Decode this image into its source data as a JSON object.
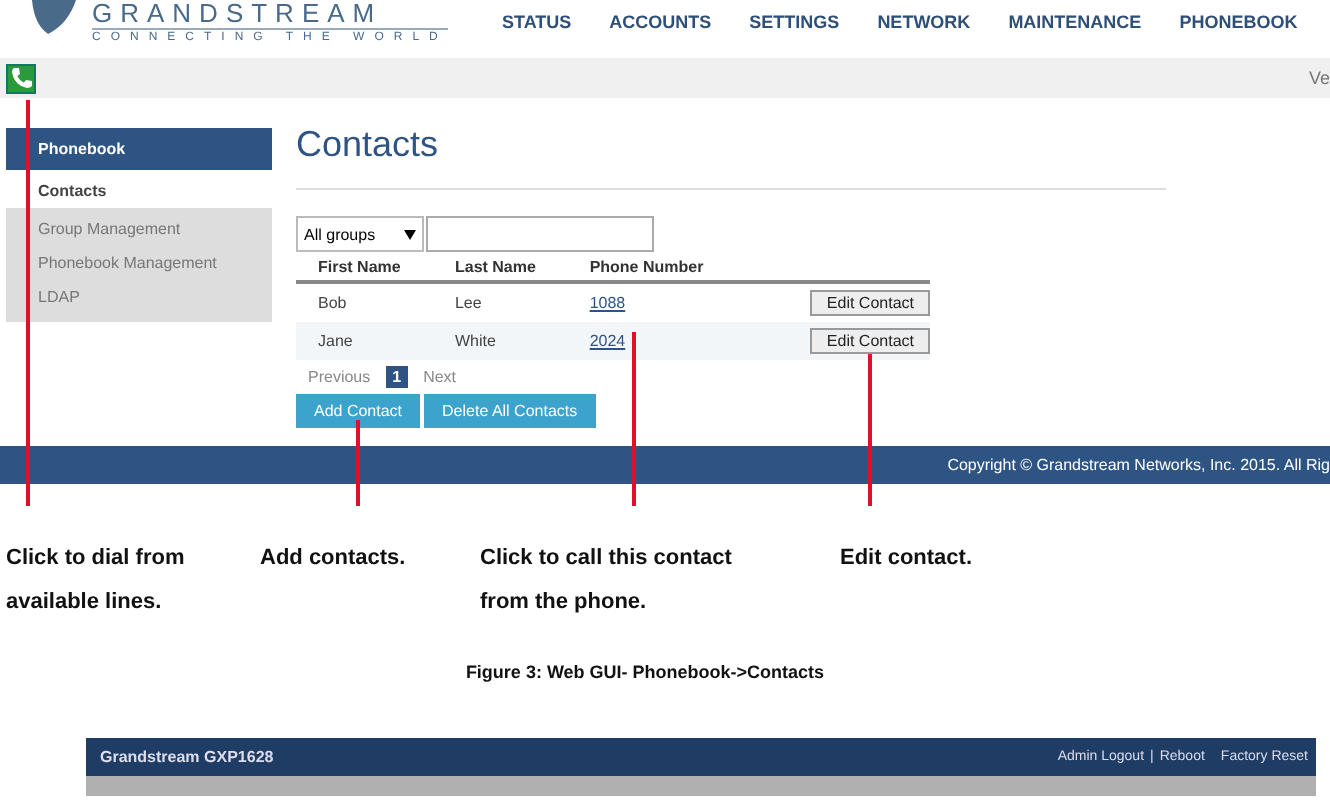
{
  "header": {
    "logo_text": "GRANDSTREAM",
    "tagline": "CONNECTING THE WORLD",
    "nav": [
      {
        "label": "STATUS"
      },
      {
        "label": "ACCOUNTS"
      },
      {
        "label": "SETTINGS"
      },
      {
        "label": "NETWORK"
      },
      {
        "label": "MAINTENANCE"
      },
      {
        "label": "PHONEBOOK"
      }
    ]
  },
  "toolbar": {
    "version_text": "Ve"
  },
  "sidebar": {
    "title": "Phonebook",
    "items": [
      {
        "label": "Contacts",
        "selected": true
      },
      {
        "label": "Group Management",
        "selected": false
      },
      {
        "label": "Phonebook Management",
        "selected": false
      },
      {
        "label": "LDAP",
        "selected": false
      }
    ]
  },
  "page": {
    "title": "Contacts",
    "group_select": "All groups",
    "columns": [
      "First Name",
      "Last Name",
      "Phone Number"
    ],
    "rows": [
      {
        "first": "Bob",
        "last": "Lee",
        "phone": "1088",
        "action": "Edit Contact"
      },
      {
        "first": "Jane",
        "last": "White",
        "phone": "2024",
        "action": "Edit Contact"
      }
    ],
    "pagination": [
      {
        "label": "Previous",
        "kind": "nav",
        "disabled": true,
        "selected": false
      },
      {
        "label": "1",
        "kind": "page",
        "disabled": false,
        "selected": true
      },
      {
        "label": "Next",
        "kind": "nav",
        "disabled": true,
        "selected": false
      }
    ],
    "buttons": [
      "Add Contact",
      "Delete All Contacts"
    ]
  },
  "footer": {
    "copyright": "Copyright © Grandstream Networks, Inc. 2015. All Rig"
  },
  "annotations": [
    {
      "lines": [
        "Click to dial from",
        "available lines."
      ]
    },
    {
      "lines": [
        "Add contacts."
      ]
    },
    {
      "lines": [
        "Click to call this contact",
        "from the phone."
      ]
    },
    {
      "lines": [
        "Edit contact."
      ]
    }
  ],
  "figure_caption": "Figure 3: Web GUI- Phonebook->Contacts",
  "second_screen": {
    "title": "Grandstream GXP1628",
    "links": [
      {
        "kind": "link",
        "text": "Admin Logout"
      },
      {
        "kind": "separator",
        "text": "|"
      },
      {
        "kind": "link",
        "text": "Reboot"
      },
      {
        "kind": "link",
        "text": "Factory Reset"
      }
    ]
  }
}
